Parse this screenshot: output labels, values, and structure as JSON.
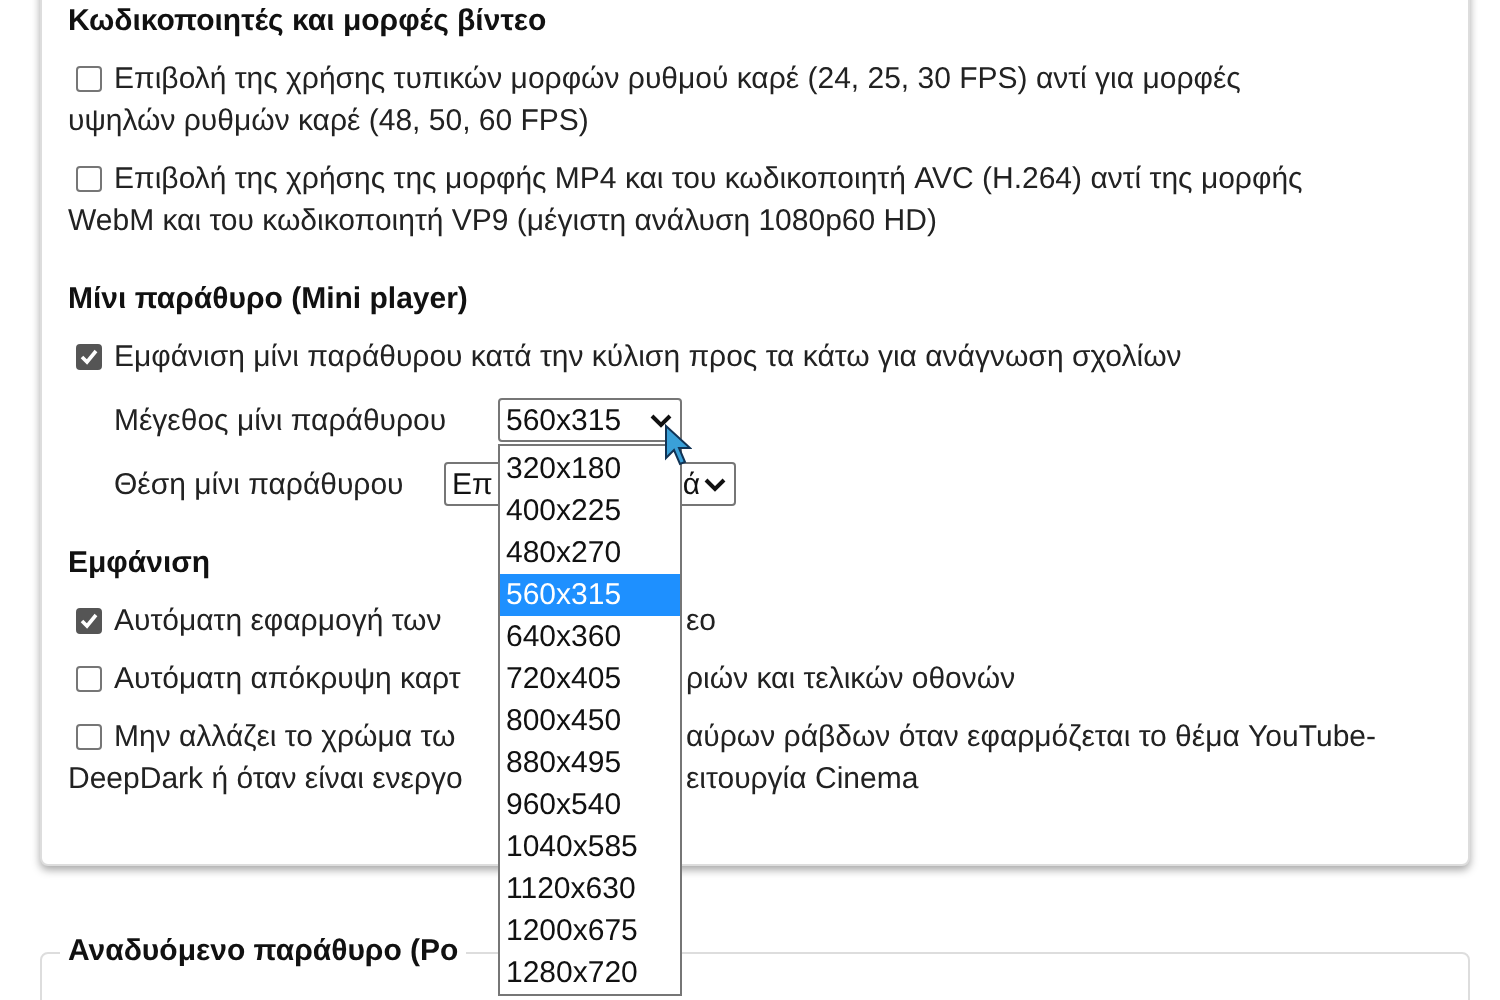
{
  "codecs": {
    "title": "Κωδικοποιητές και μορφές βίντεο",
    "options": [
      {
        "checked": false,
        "lines": [
          "Επιβολή της χρήσης τυπικών μορφών ρυθμού καρέ (24, 25, 30 FPS) αντί για μορφές",
          "υψηλών ρυθμών καρέ (48, 50, 60 FPS)"
        ]
      },
      {
        "checked": false,
        "lines": [
          "Επιβολή της χρήσης της μορφής MP4 και του κωδικοποιητή AVC (H.264) αντί της μορφής",
          "WebM και του κωδικοποιητή VP9 (μέγιστη ανάλυση 1080p60 HD)"
        ]
      }
    ]
  },
  "mini_player": {
    "title": "Μίνι παράθυρο (Mini player)",
    "option": {
      "checked": true,
      "text": "Εμφάνιση μίνι παράθυρου κατά την κύλιση προς τα κάτω για ανάγνωση σχολίων"
    },
    "size": {
      "label": "Μέγεθος μίνι παράθυρου",
      "value": "560x315",
      "expanded": true,
      "options": [
        {
          "label": "320x180",
          "selected": false
        },
        {
          "label": "400x225",
          "selected": false
        },
        {
          "label": "480x270",
          "selected": false
        },
        {
          "label": "560x315",
          "selected": true
        },
        {
          "label": "640x360",
          "selected": false
        },
        {
          "label": "720x405",
          "selected": false
        },
        {
          "label": "800x450",
          "selected": false
        },
        {
          "label": "880x495",
          "selected": false
        },
        {
          "label": "960x540",
          "selected": false
        },
        {
          "label": "1040x585",
          "selected": false
        },
        {
          "label": "1120x630",
          "selected": false
        },
        {
          "label": "1200x675",
          "selected": false
        },
        {
          "label": "1280x720",
          "selected": false
        }
      ]
    },
    "position": {
      "label": "Θέση μίνι παράθυρου",
      "value_start": "Επ",
      "value_end": "ά"
    }
  },
  "appearance": {
    "title": "Εμφάνιση",
    "options": [
      {
        "checked": true,
        "lines": [
          {
            "left": "Αυτόματη εφαρμογή των",
            "right": "εο"
          }
        ]
      },
      {
        "checked": false,
        "lines": [
          {
            "left": "Αυτόματη απόκρυψη καρτ",
            "right": "ριών και τελικών οθονών"
          }
        ]
      },
      {
        "checked": false,
        "lines": [
          {
            "left": "Μην αλλάζει το χρώμα τω",
            "right": "αύρων ράβδων όταν εφαρμόζεται το θέμα YouTube-"
          },
          {
            "left": "DeepDark ή όταν είναι ενεργο",
            "right": "ειτουργία Cinema"
          }
        ]
      }
    ]
  },
  "popup": {
    "title": "Αναδυόμενο παράθυρο (Po"
  }
}
